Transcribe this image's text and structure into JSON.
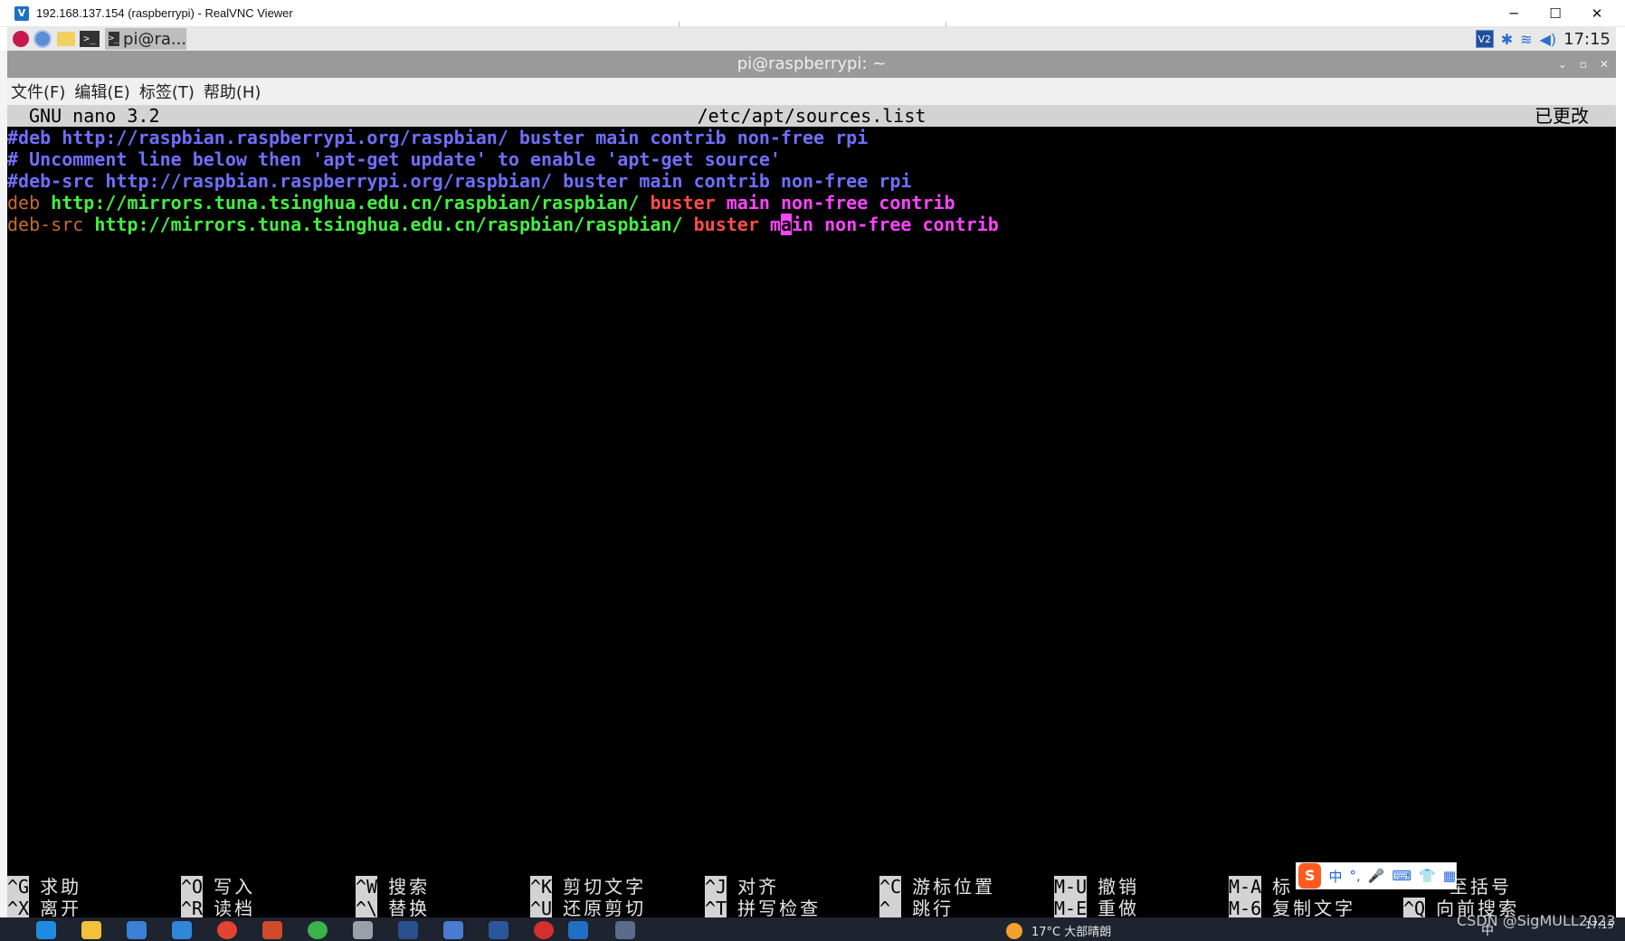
{
  "vnc_window": {
    "title": "192.168.137.154 (raspberrypi) - RealVNC Viewer",
    "minimize": "─",
    "maximize": "☐",
    "close": "✕"
  },
  "pi_panel": {
    "task_label": "pi@ra...",
    "clock": "17:15",
    "vnc_tray": "V2"
  },
  "terminal_window": {
    "title": "pi@raspberrypi: ~",
    "menus": [
      "文件(F)",
      "编辑(E)",
      "标签(T)",
      "帮助(H)"
    ]
  },
  "nano": {
    "version": "GNU nano 3.2",
    "filename": "/etc/apt/sources.list",
    "status": "已更改",
    "lines": {
      "l1": "#deb http://raspbian.raspberrypi.org/raspbian/ buster main contrib non-free rpi",
      "l2": "# Uncomment line below then 'apt-get update' to enable 'apt-get source'",
      "l3": "#deb-src http://raspbian.raspberrypi.org/raspbian/ buster main contrib non-free rpi",
      "l4": {
        "keyword": "deb",
        "url": "http://mirrors.tuna.tsinghua.edu.cn/raspbian/raspbian/",
        "suite": "buster",
        "rest": "main non-free contrib"
      },
      "l5": {
        "keyword": "deb-src",
        "url": "http://mirrors.tuna.tsinghua.edu.cn/raspbian/raspbian/",
        "suite": "buster",
        "rest_pre": "m",
        "cursor_char": "a",
        "rest_post": "in non-free contrib"
      }
    },
    "shortcuts_row1": [
      {
        "key": "^G",
        "label": "求助"
      },
      {
        "key": "^O",
        "label": "写入"
      },
      {
        "key": "^W",
        "label": "搜索"
      },
      {
        "key": "^K",
        "label": "剪切文字"
      },
      {
        "key": "^J",
        "label": "对齐"
      },
      {
        "key": "^C",
        "label": "游标位置"
      },
      {
        "key": "M-U",
        "label": "撤销"
      },
      {
        "key": "M-A",
        "label": "标"
      },
      {
        "key": "",
        "label": "至括号"
      }
    ],
    "shortcuts_row2": [
      {
        "key": "^X",
        "label": "离开"
      },
      {
        "key": "^R",
        "label": "读档"
      },
      {
        "key": "^\\",
        "label": "替换"
      },
      {
        "key": "^U",
        "label": "还原剪切"
      },
      {
        "key": "^T",
        "label": "拼写检查"
      },
      {
        "key": "^_",
        "label": "跳行"
      },
      {
        "key": "M-E",
        "label": "重做"
      },
      {
        "key": "M-6",
        "label": "复制文字"
      },
      {
        "key": "^Q",
        "label": "向前搜索"
      }
    ]
  },
  "ime_toolbar": {
    "logo": "S",
    "mode": "中",
    "punct": "°,",
    "mic": "🎤",
    "keyboard": "⌨",
    "skin": "👕",
    "menu": "▦"
  },
  "taskbar": {
    "weather": "17°C 大部晴朗",
    "ime_indicator": "中",
    "clock": "17:15",
    "watermark": "CSDN @SigMULL2023"
  },
  "colors": {
    "comment": "#6f6fff",
    "url": "#44ee44",
    "suite": "#ff4c4c",
    "keyword": "#ff44ff",
    "deb": "#c86a2e",
    "terminal_bg": "#000000"
  }
}
